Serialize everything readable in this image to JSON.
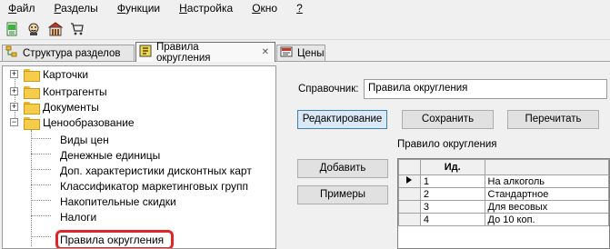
{
  "menu": {
    "items": [
      {
        "label": "Файл",
        "u": "Ф",
        "rest": "айл"
      },
      {
        "label": "Разделы",
        "u": "Р",
        "rest": "азделы"
      },
      {
        "label": "Функции",
        "u": "Ф",
        "rest": "ункции"
      },
      {
        "label": "Настройка",
        "u": "Н",
        "rest": "астройка"
      },
      {
        "label": "Окно",
        "u": "О",
        "rest": "кно"
      },
      {
        "label": "?",
        "u": "?",
        "rest": ""
      }
    ]
  },
  "toolbar": {
    "icons": [
      "green-document-icon",
      "person-icon",
      "shop-icon",
      "cart-icon"
    ]
  },
  "tabs": [
    {
      "label": "Структура разделов",
      "icon": "tree-icon",
      "active": false
    },
    {
      "label": "Правила округления",
      "icon": "form-icon",
      "active": true,
      "closable": true
    },
    {
      "label": "Цены",
      "icon": "price-icon",
      "active": false
    }
  ],
  "tree": {
    "items": [
      {
        "label": "Карточки",
        "type": "folder",
        "expander": "+"
      },
      {
        "label": "Контрагенты",
        "type": "folder",
        "expander": "+"
      },
      {
        "label": "Документы",
        "type": "folder",
        "expander": "+"
      },
      {
        "label": "Ценообразование",
        "type": "folder",
        "expander": "−"
      },
      {
        "label": "Виды цен",
        "type": "leaf"
      },
      {
        "label": "Денежные единицы",
        "type": "leaf"
      },
      {
        "label": "Доп. характеристики дисконтных карт",
        "type": "leaf"
      },
      {
        "label": "Классификатор маркетинговых групп",
        "type": "leaf"
      },
      {
        "label": "Накопительные скидки",
        "type": "leaf"
      },
      {
        "label": "Налоги",
        "type": "leaf"
      },
      {
        "label": "Правила округления",
        "type": "leaf",
        "highlighted": true
      }
    ]
  },
  "right": {
    "reference_label": "Справочник:",
    "reference_value": "Правила округления",
    "edit_button": "Редактирование",
    "save_button": "Сохранить",
    "reread_button": "Перечитать",
    "grid_caption": "Правило округления",
    "add_button": "Добавить",
    "examples_button": "Примеры",
    "grid": {
      "columns": [
        "Ид.",
        ""
      ],
      "rows": [
        {
          "id": "1",
          "name": "На алкоголь",
          "current": true
        },
        {
          "id": "2",
          "name": "Стандартное"
        },
        {
          "id": "3",
          "name": "Для весовых"
        },
        {
          "id": "4",
          "name": "До 10 коп."
        }
      ]
    }
  },
  "colors": {
    "highlight": "#e1262a",
    "primary_button": "#dbe8f6"
  }
}
